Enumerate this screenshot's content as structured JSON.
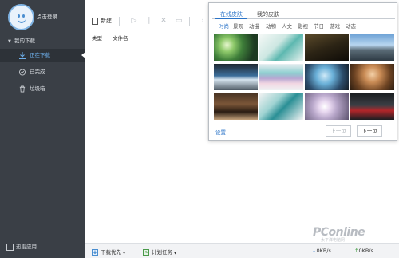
{
  "sidebar": {
    "login_text": "点击登录",
    "group_label": "我的下载",
    "items": [
      {
        "label": "正在下载",
        "icon": "download-arrow-icon"
      },
      {
        "label": "已完成",
        "icon": "check-circle-icon"
      },
      {
        "label": "垃圾箱",
        "icon": "trash-icon"
      }
    ],
    "bottom_app_label": "迅雷应用"
  },
  "toolbar": {
    "new_label": "新建",
    "icons": [
      "play-icon",
      "pause-icon",
      "delete-icon",
      "folder-icon"
    ]
  },
  "list_headers": [
    "类型",
    "文件名"
  ],
  "statusbar": {
    "download_priority": "下载优先",
    "scheduled_task": "计划任务",
    "down_speed": "0KB/s",
    "up_speed": "0KB/s"
  },
  "skin_popup": {
    "tabs": [
      "在线皮肤",
      "我的皮肤"
    ],
    "categories": [
      "时尚",
      "景观",
      "动漫",
      "动物",
      "人文",
      "影视",
      "节日",
      "游戏",
      "动态"
    ],
    "thumbnails": [
      "green-bokeh",
      "teal-objects",
      "dark-figure",
      "mountain-lake",
      "blue-car",
      "macarons",
      "feather-blue",
      "child-portrait",
      "old-radio",
      "teal-gifts",
      "sparkler",
      "red-sportscar"
    ],
    "settings_link": "设置",
    "prev_label": "上一页",
    "next_label": "下一页"
  },
  "watermark": {
    "brand": "PConline",
    "sub": "太平洋电脑网"
  },
  "colors": {
    "sidebar_bg": "#3a3f46",
    "accent": "#2b74c8"
  }
}
